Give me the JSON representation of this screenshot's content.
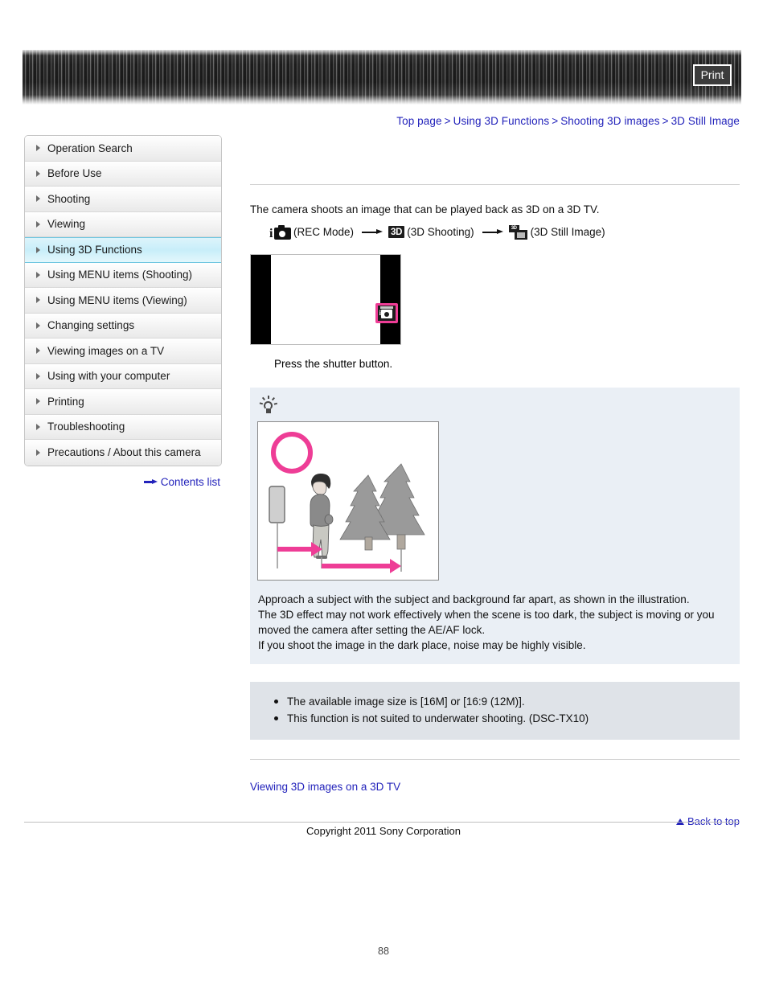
{
  "header": {
    "print_label": "Print"
  },
  "breadcrumb": {
    "items": [
      "Top page",
      "Using 3D Functions",
      "Shooting 3D images",
      "3D Still Image"
    ],
    "separator": ">"
  },
  "sidebar": {
    "items": [
      {
        "label": "Operation Search",
        "active": false
      },
      {
        "label": "Before Use",
        "active": false
      },
      {
        "label": "Shooting",
        "active": false
      },
      {
        "label": "Viewing",
        "active": false
      },
      {
        "label": "Using 3D Functions",
        "active": true
      },
      {
        "label": "Using MENU items (Shooting)",
        "active": false
      },
      {
        "label": "Using MENU items (Viewing)",
        "active": false
      },
      {
        "label": "Changing settings",
        "active": false
      },
      {
        "label": "Viewing images on a TV",
        "active": false
      },
      {
        "label": "Using with your computer",
        "active": false
      },
      {
        "label": "Printing",
        "active": false
      },
      {
        "label": "Troubleshooting",
        "active": false
      },
      {
        "label": "Precautions / About this camera",
        "active": false
      }
    ],
    "contents_list_label": "Contents list"
  },
  "main": {
    "intro": "The camera shoots an image that can be played back as 3D on a 3D TV.",
    "flow": {
      "step1_label": "(REC Mode)",
      "step2_icon_text": "3D",
      "step2_label": "(3D Shooting)",
      "step3_icon_text": "3D",
      "step3_label": "(3D Still Image)"
    },
    "caption": "Press the shutter button.",
    "tip": {
      "lines": [
        "Approach a subject with the subject and background far apart, as shown in the illustration.",
        "The 3D effect may not work effectively when the scene is too dark, the subject is moving or you moved the camera after setting the AE/AF lock.",
        "If you shoot the image in the dark place, noise may be highly visible."
      ]
    },
    "notes": [
      "The available image size is [16M] or [16:9 (12M)].",
      "This function is not suited to underwater shooting. (DSC-TX10)"
    ],
    "related_link": "Viewing 3D images on a 3D TV",
    "back_to_top": "Back to top"
  },
  "footer": {
    "copyright": "Copyright 2011 Sony Corporation",
    "page_number": "88"
  },
  "colors": {
    "link": "#2323bb",
    "accent_pink": "#ee3d96",
    "sidebar_active": "#c8eef9",
    "tip_bg": "#eaeff5",
    "notes_bg": "#dfe3e8"
  }
}
